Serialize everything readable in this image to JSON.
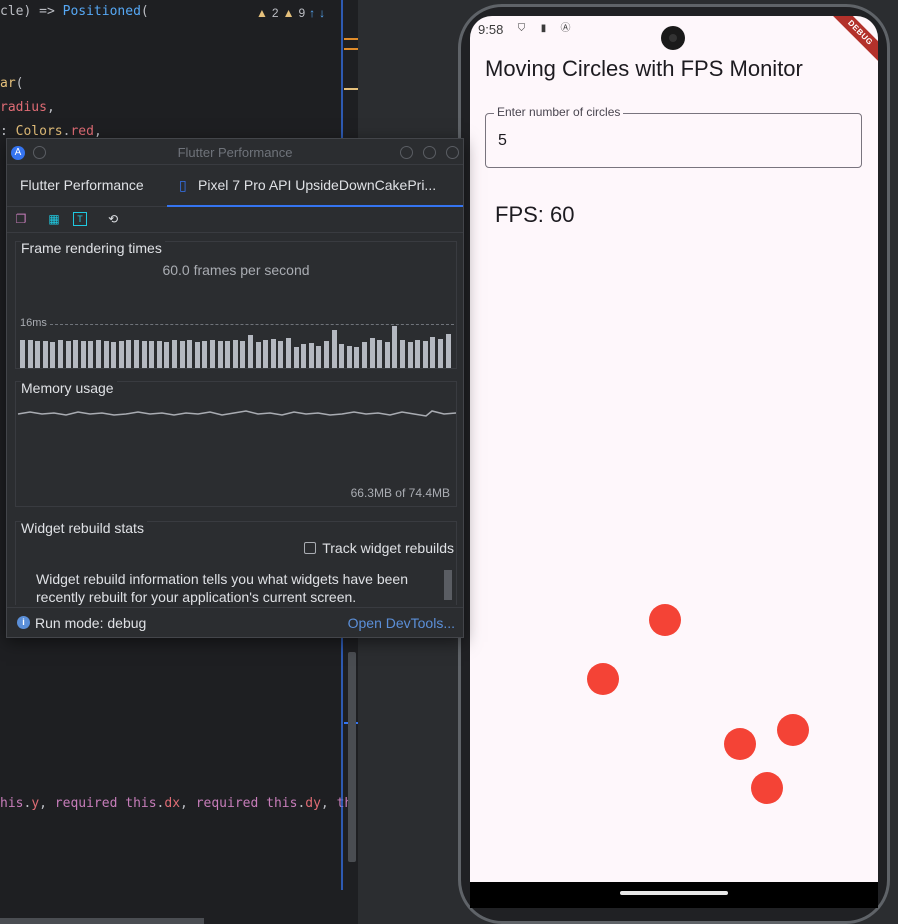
{
  "editor": {
    "lines": [
      {
        "parts": [
          [
            "plain",
            "cle) => "
          ],
          [
            "fn",
            "Positioned"
          ],
          [
            "plain",
            "("
          ]
        ]
      },
      {
        "parts": [
          [
            "cls",
            "ar"
          ],
          [
            "plain",
            "("
          ]
        ]
      },
      {
        "parts": [
          [
            "str",
            "radius"
          ],
          [
            "plain",
            ","
          ]
        ]
      },
      {
        "parts": [
          [
            "plain",
            ": "
          ],
          [
            "cls",
            "Colors"
          ],
          [
            "plain",
            "."
          ],
          [
            "str",
            "red"
          ],
          [
            "plain",
            ","
          ]
        ]
      },
      {
        "parts": [
          [
            "prop",
            "his"
          ],
          [
            "plain",
            "."
          ],
          [
            "str",
            "y"
          ],
          [
            "plain",
            ", "
          ],
          [
            "prop",
            "required this"
          ],
          [
            "plain",
            "."
          ],
          [
            "str",
            "dx"
          ],
          [
            "plain",
            ", "
          ],
          [
            "prop",
            "required this"
          ],
          [
            "plain",
            "."
          ],
          [
            "str",
            "dy"
          ],
          [
            "plain",
            ", "
          ],
          [
            "prop",
            "th"
          ]
        ]
      }
    ],
    "inspections": {
      "warnings_a": "2",
      "warnings_b": "9"
    }
  },
  "perf_panel": {
    "window_title": "Flutter Performance",
    "tabs": [
      {
        "label": "Flutter Performance"
      },
      {
        "label": "Pixel 7 Pro API UpsideDownCakePri..."
      }
    ],
    "toolbar_icons": [
      "layers-icon",
      "checker-icon",
      "text-icon",
      "history-icon"
    ],
    "frame_section": {
      "label": "Frame rendering times",
      "fps_text": "60.0 frames per second",
      "threshold_label": "16ms"
    },
    "memory_section": {
      "label": "Memory usage",
      "footer": "66.3MB of 74.4MB"
    },
    "rebuild_section": {
      "label": "Widget rebuild stats",
      "track_label": "Track widget rebuilds",
      "track_checked": false,
      "info": "Widget rebuild information tells you what widgets have been recently rebuilt for your application's current screen."
    },
    "footer": {
      "run_mode": "Run mode: debug",
      "devtools_link": "Open DevTools..."
    }
  },
  "phone": {
    "status": {
      "time": "9:58"
    },
    "debug_banner": "DEBUG",
    "app_title": "Moving Circles with FPS Monitor",
    "input": {
      "label": "Enter number of circles",
      "value": "5"
    },
    "fps_label": "FPS: 60",
    "circle_color": "#f44336"
  }
}
